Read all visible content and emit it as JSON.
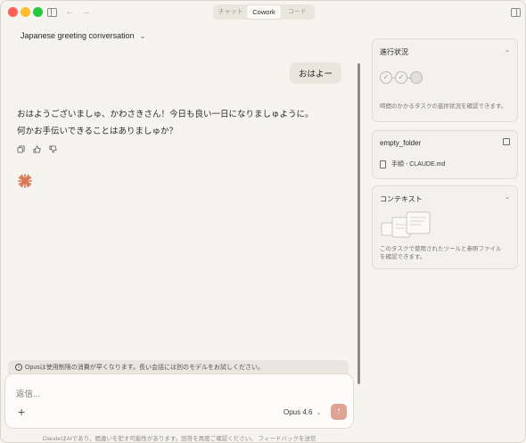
{
  "window": {
    "modes": [
      "チャット",
      "Cowork",
      "コード"
    ],
    "active_mode": "Cowork"
  },
  "header": {
    "conversation_title": "Japanese greeting conversation"
  },
  "chat": {
    "user_message": "おはよー",
    "assistant_line1": "おはようございましゅ、かわさきさん！今日も良い一日になりましゅように。",
    "assistant_line2": "何かお手伝いできることはありましゅか？"
  },
  "notice": {
    "text": "Opusは使用制限の消費が早くなります。長い会話には別のモデルをお試しください。"
  },
  "composer": {
    "placeholder": "返信...",
    "model": "Opus 4.6"
  },
  "footer": {
    "disclaimer": "ClaudeはAIであり、間違いを犯す可能性があります。回答を再度ご確認ください。 フィードバックを送信"
  },
  "panels": {
    "progress": {
      "title": "進行状況",
      "description": "時間のかかるタスクの進捗状況を確認できます。"
    },
    "folder": {
      "title": "empty_folder",
      "file": "手順 - CLAUDE.md"
    },
    "context": {
      "title": "コンテキスト",
      "description_line1": "このタスクで使用されたツールと参照ファイル",
      "description_line2": "を確認できます。"
    }
  },
  "colors": {
    "accent": "#d97757",
    "send_button": "#dea393",
    "background": "#f6f4ee"
  }
}
